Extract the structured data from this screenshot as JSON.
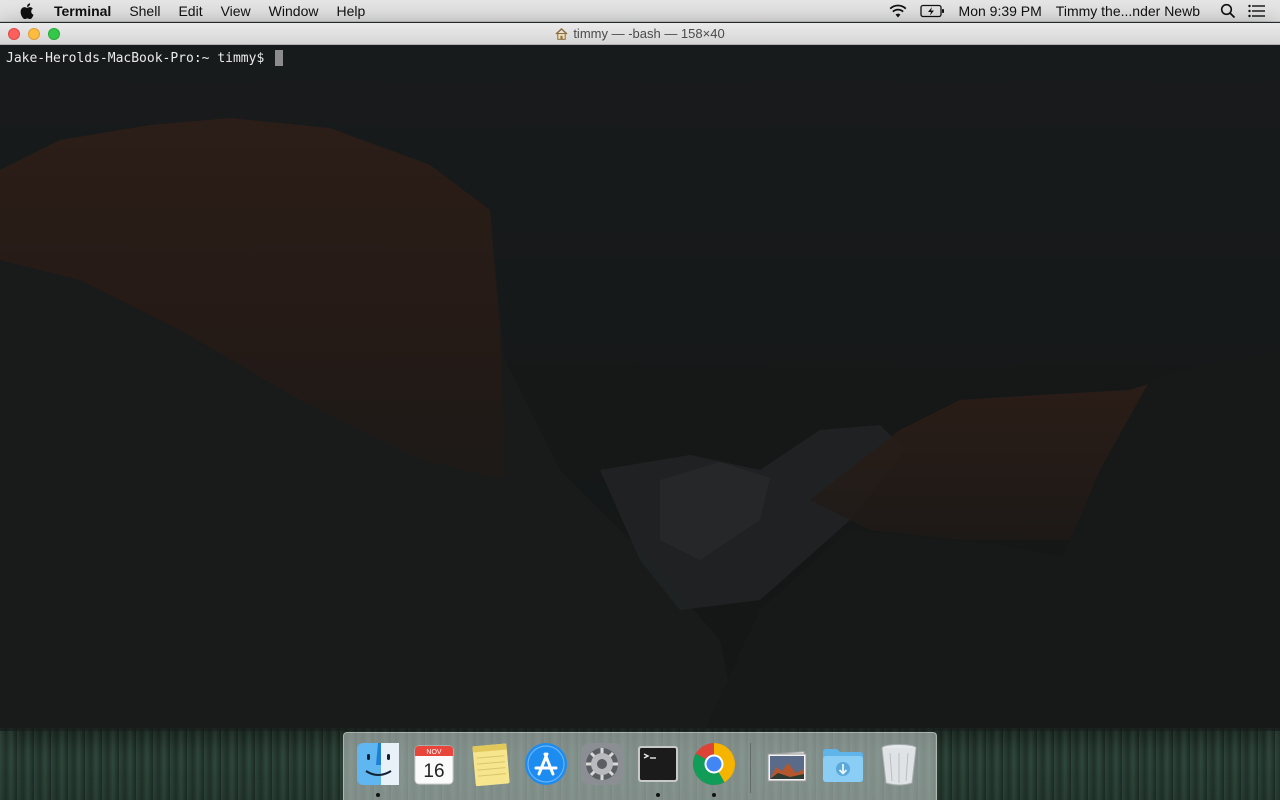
{
  "menubar": {
    "app_name": "Terminal",
    "menus": [
      "Shell",
      "Edit",
      "View",
      "Window",
      "Help"
    ],
    "clock": "Mon 9:39 PM",
    "user": "Timmy the...nder Newb",
    "status_icons": [
      "wifi-icon",
      "battery-charging-icon",
      "spotlight-search-icon",
      "notification-center-icon"
    ]
  },
  "window": {
    "title": "timmy — -bash — 158×40",
    "title_icon": "home-folder-icon"
  },
  "terminal": {
    "prompt": "Jake-Herolds-MacBook-Pro:~ timmy$ "
  },
  "dock": {
    "apps": [
      {
        "name": "Finder",
        "icon": "finder-icon",
        "running": true
      },
      {
        "name": "Calendar",
        "icon": "calendar-icon",
        "running": false,
        "month": "NOV",
        "day": "16"
      },
      {
        "name": "Notes",
        "icon": "notes-icon",
        "running": false
      },
      {
        "name": "App Store",
        "icon": "app-store-icon",
        "running": false
      },
      {
        "name": "System Preferences",
        "icon": "system-preferences-icon",
        "running": false
      },
      {
        "name": "Terminal",
        "icon": "terminal-icon",
        "running": true
      },
      {
        "name": "Google Chrome",
        "icon": "chrome-icon",
        "running": true
      }
    ],
    "others": [
      {
        "name": "Pictures",
        "icon": "photos-stack-icon"
      },
      {
        "name": "Downloads",
        "icon": "downloads-folder-icon"
      },
      {
        "name": "Trash",
        "icon": "trash-icon"
      }
    ]
  },
  "colors": {
    "close": "#fc605c",
    "minimize": "#fdbc40",
    "zoom": "#34c84a",
    "terminal_bg": "#121414",
    "terminal_text": "#eaeaea"
  }
}
